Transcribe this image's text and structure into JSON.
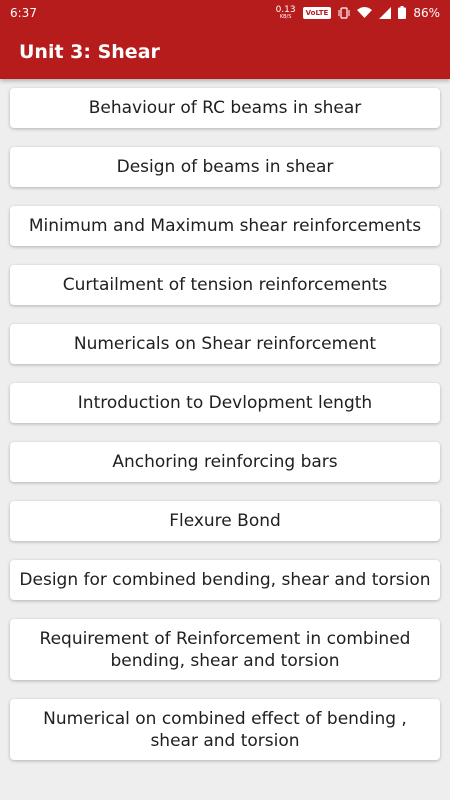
{
  "status_bar": {
    "time": "6:37",
    "net_speed_value": "0.13",
    "net_speed_unit": "KB/S",
    "volte_label": "VoLTE",
    "battery_text": "86%",
    "icons": [
      "vibrate-icon",
      "wifi-icon",
      "signal-icon",
      "battery-icon"
    ]
  },
  "app_bar": {
    "title": "Unit 3: Shear",
    "background_color": "#b71c1c"
  },
  "topics": [
    "Behaviour of RC beams in shear",
    "Design of beams in shear",
    "Minimum and Maximum shear reinforcements",
    "Curtailment of tension reinforcements",
    "Numericals on Shear reinforcement",
    "Introduction to Devlopment length",
    "Anchoring reinforcing bars",
    "Flexure Bond",
    "Design for combined bending, shear and torsion",
    "Requirement of Reinforcement in combined bending, shear and torsion",
    "Numerical on combined effect of bending , shear and torsion"
  ]
}
